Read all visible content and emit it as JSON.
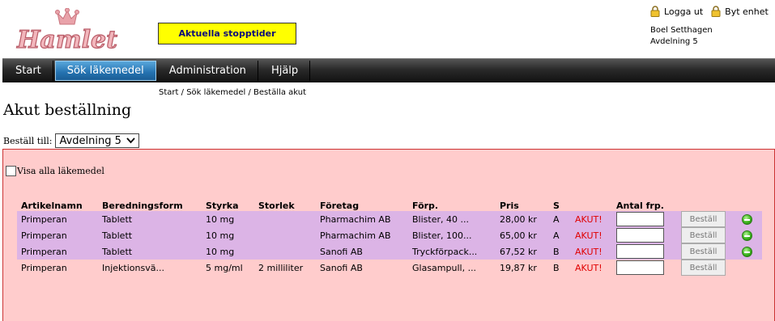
{
  "logo": {
    "text": "Hamlet"
  },
  "header": {
    "stop_times": "Aktuella stopptider",
    "logout": "Logga ut",
    "switch_unit": "Byt enhet",
    "user_name": "Boel Setthagen",
    "user_unit": "Avdelning 5"
  },
  "nav": {
    "items": [
      "Start",
      "Sök läkemedel",
      "Administration",
      "Hjälp"
    ],
    "active": "Sök läkemedel"
  },
  "breadcrumb": [
    "Start",
    "Sök läkemedel",
    "Beställa akut"
  ],
  "page": {
    "title": "Akut beställning",
    "order_to_label": "Beställ till:",
    "order_to_value": "Avdelning 5",
    "show_all_label": "Visa alla läkemedel"
  },
  "table": {
    "headers": [
      "Artikelnamn",
      "Beredningsform",
      "Styrka",
      "Storlek",
      "Företag",
      "Förp.",
      "Pris",
      "S",
      "",
      "Antal frp."
    ],
    "order_button": "Beställ",
    "rows": [
      {
        "name": "Primperan",
        "form": "Tablett",
        "strength": "10 mg",
        "size": "",
        "company": "Pharmachim AB",
        "package": "Blister, 40 ...",
        "price": "28,00 kr",
        "s": "A",
        "flag": "AKUT!",
        "highlight": true,
        "status_icon": "green-status-icon"
      },
      {
        "name": "Primperan",
        "form": "Tablett",
        "strength": "10 mg",
        "size": "",
        "company": "Pharmachim AB",
        "package": "Blister, 100...",
        "price": "65,00 kr",
        "s": "A",
        "flag": "AKUT!",
        "highlight": true,
        "status_icon": "green-status-icon"
      },
      {
        "name": "Primperan",
        "form": "Tablett",
        "strength": "10 mg",
        "size": "",
        "company": "Sanofi AB",
        "package": "Tryckförpack...",
        "price": "67,52 kr",
        "s": "B",
        "flag": "AKUT!",
        "highlight": true,
        "status_icon": "green-status-icon"
      },
      {
        "name": "Primperan",
        "form": "Injektionsvä...",
        "strength": "5 mg/ml",
        "size": "2 milliliter",
        "company": "Sanofi AB",
        "package": "Glasampull, ...",
        "price": "19,87 kr",
        "s": "B",
        "flag": "AKUT!",
        "highlight": false,
        "status_icon": ""
      }
    ]
  },
  "colors": {
    "stop_button": "#ffff00",
    "panel_bg": "#ffcccc",
    "row_highlight": "#dcb4e6",
    "akut": "#e00000",
    "nav_active": "#2472b0"
  }
}
